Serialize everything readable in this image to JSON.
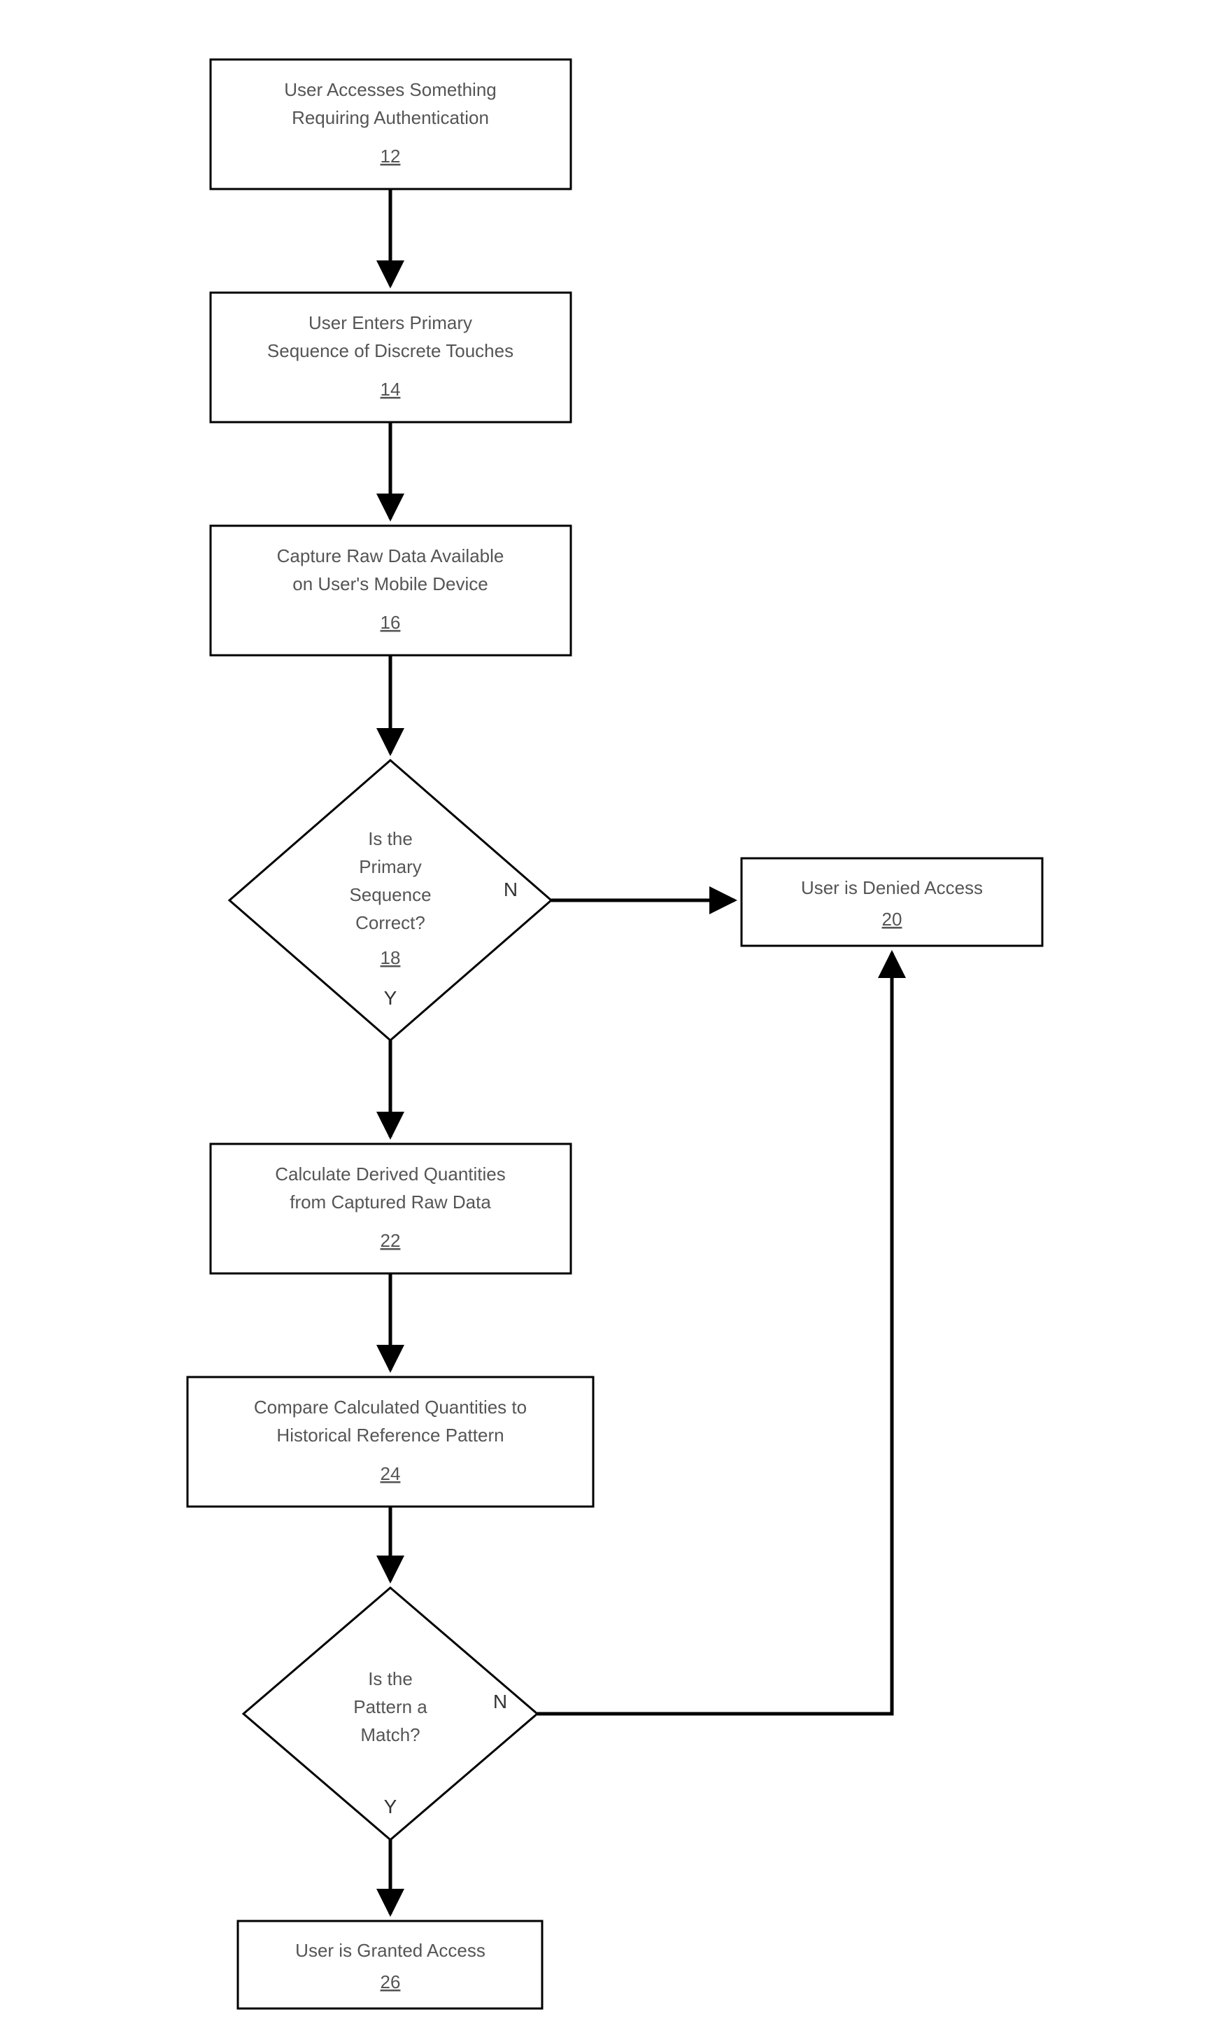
{
  "chart_data": {
    "type": "flowchart",
    "nodes": [
      {
        "id": "12",
        "shape": "rect",
        "lines": [
          "User Accesses Something",
          "Requiring Authentication"
        ],
        "ref": "12"
      },
      {
        "id": "14",
        "shape": "rect",
        "lines": [
          "User Enters Primary",
          "Sequence of Discrete Touches"
        ],
        "ref": "14"
      },
      {
        "id": "16",
        "shape": "rect",
        "lines": [
          "Capture Raw Data Available",
          "on User's Mobile Device"
        ],
        "ref": "16"
      },
      {
        "id": "18",
        "shape": "diamond",
        "lines": [
          "Is the",
          "Primary",
          "Sequence",
          "Correct?"
        ],
        "ref": "18"
      },
      {
        "id": "20",
        "shape": "rect",
        "lines": [
          "User is Denied Access"
        ],
        "ref": "20"
      },
      {
        "id": "22",
        "shape": "rect",
        "lines": [
          "Calculate Derived Quantities",
          "from Captured Raw Data"
        ],
        "ref": "22"
      },
      {
        "id": "24",
        "shape": "rect",
        "lines": [
          "Compare Calculated Quantities to",
          "Historical Reference Pattern"
        ],
        "ref": "24"
      },
      {
        "id": "R",
        "shape": "diamond",
        "lines": [
          "Is the",
          "Pattern a",
          "Match?"
        ],
        "ref": ""
      },
      {
        "id": "26",
        "shape": "rect",
        "lines": [
          "User is Granted Access"
        ],
        "ref": "26"
      }
    ],
    "edges": [
      {
        "from": "12",
        "to": "14",
        "label": ""
      },
      {
        "from": "14",
        "to": "16",
        "label": ""
      },
      {
        "from": "16",
        "to": "18",
        "label": ""
      },
      {
        "from": "18",
        "to": "20",
        "label": "N"
      },
      {
        "from": "18",
        "to": "22",
        "label": "Y"
      },
      {
        "from": "22",
        "to": "24",
        "label": ""
      },
      {
        "from": "24",
        "to": "R",
        "label": ""
      },
      {
        "from": "R",
        "to": "26",
        "label": "Y"
      },
      {
        "from": "R",
        "to": "20",
        "label": "N"
      }
    ]
  },
  "labels": {
    "n12a": "User Accesses Something",
    "n12b": "Requiring Authentication",
    "r12": "12",
    "n14a": "User Enters Primary",
    "n14b": "Sequence of Discrete Touches",
    "r14": "14",
    "n16a": "Capture Raw Data Available",
    "n16b": "on User's Mobile Device",
    "r16": "16",
    "n18a": "Is the",
    "n18b": "Primary",
    "n18c": "Sequence",
    "n18d": "Correct?",
    "r18": "18",
    "n20a": "User is Denied Access",
    "r20": "20",
    "n22a": "Calculate Derived Quantities",
    "n22b": "from Captured Raw Data",
    "r22": "22",
    "n24a": "Compare Calculated Quantities to",
    "n24b": "Historical Reference Pattern",
    "r24": "24",
    "nRa": "Is the",
    "nRb": "Pattern a",
    "nRc": "Match?",
    "n26a": "User is Granted Access",
    "r26": "26",
    "Y": "Y",
    "N": "N"
  }
}
